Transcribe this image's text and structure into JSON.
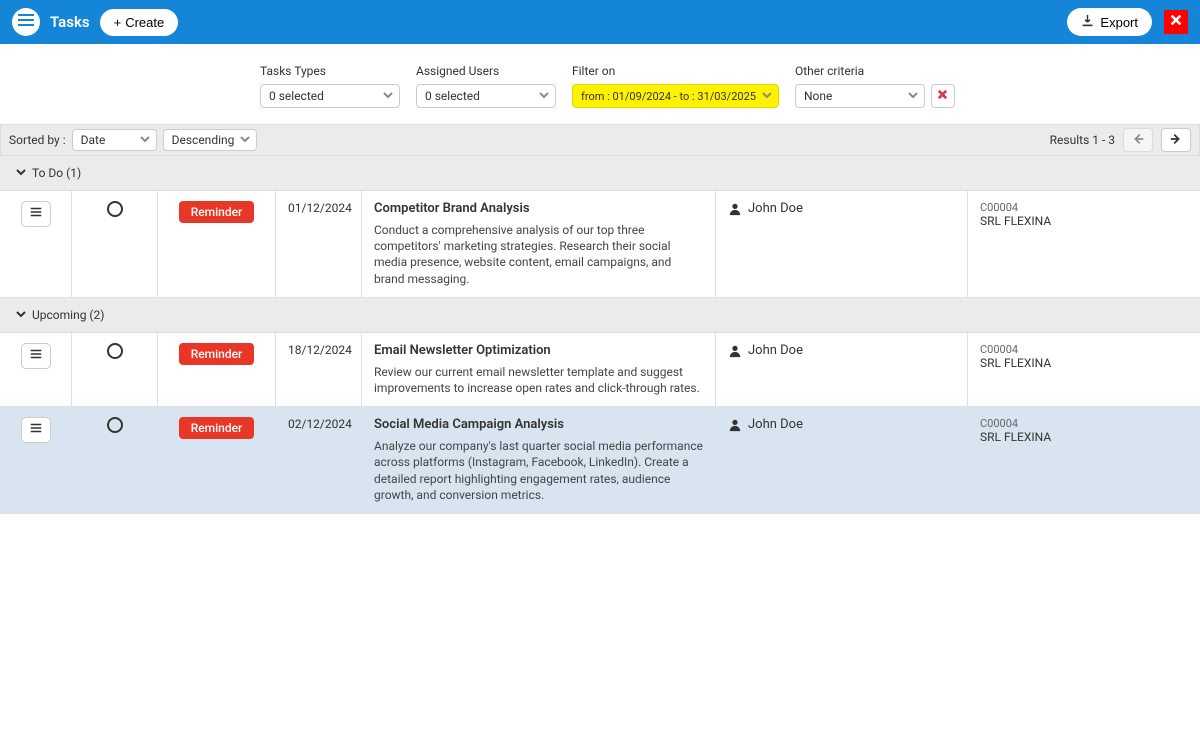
{
  "header": {
    "title": "Tasks",
    "create_label": "Create",
    "export_label": "Export"
  },
  "filters": {
    "types": {
      "label": "Tasks Types",
      "value": "0 selected"
    },
    "users": {
      "label": "Assigned Users",
      "value": "0 selected"
    },
    "filter_on": {
      "label": "Filter on",
      "value": "from : 01/09/2024 - to : 31/03/2025"
    },
    "other": {
      "label": "Other criteria",
      "value": "None"
    }
  },
  "sort": {
    "label": "Sorted by :",
    "field": "Date",
    "direction": "Descending",
    "results_label": "Results 1 - 3"
  },
  "groups": [
    {
      "title": "To Do (1)",
      "tasks": [
        {
          "tag": "Reminder",
          "date": "01/12/2024",
          "title": "Competitor Brand Analysis",
          "desc": "Conduct a comprehensive analysis of our top three competitors' marketing strategies. Research their social media presence, website content, email campaigns, and brand messaging.",
          "user": "John Doe",
          "company_code": "C00004",
          "company_name": "SRL FLEXINA",
          "selected": false
        }
      ]
    },
    {
      "title": "Upcoming (2)",
      "tasks": [
        {
          "tag": "Reminder",
          "date": "18/12/2024",
          "title": "Email Newsletter Optimization",
          "desc": "Review our current email newsletter template and suggest improvements to increase open rates and click-through rates.",
          "user": "John Doe",
          "company_code": "C00004",
          "company_name": "SRL FLEXINA",
          "selected": false
        },
        {
          "tag": "Reminder",
          "date": "02/12/2024",
          "title": "Social Media Campaign Analysis",
          "desc": "Analyze our company's last quarter social media performance across platforms (Instagram, Facebook, LinkedIn). Create a detailed report highlighting engagement rates, audience growth, and conversion metrics.",
          "user": "John Doe",
          "company_code": "C00004",
          "company_name": "SRL FLEXINA",
          "selected": true
        }
      ]
    }
  ]
}
